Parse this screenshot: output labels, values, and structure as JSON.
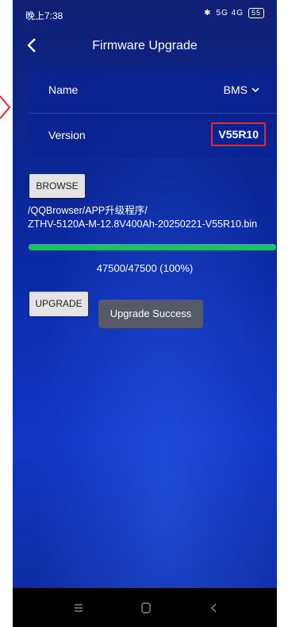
{
  "status_bar": {
    "time": "晚上7:38",
    "signals": "5G  4G",
    "battery": "55"
  },
  "header": {
    "title": "Firmware Upgrade"
  },
  "info": {
    "name_label": "Name",
    "name_value": "BMS",
    "version_label": "Version",
    "version_value": "V55R10"
  },
  "browse_button": "BROWSE",
  "file_path_line1": "/QQBrowser/APP升级程序/",
  "file_path_line2": "ZTHV-5120A-M-12.8V400Ah-20250221-V55R10.bin",
  "progress": {
    "fraction": 1.0,
    "text": "47500/47500 (100%)"
  },
  "upgrade_button": "UPGRADE",
  "toast": "Upgrade Success",
  "colors": {
    "accent_progress": "#1fbf6a",
    "highlight": "#e52a2a",
    "bg": "#0b2aa8"
  }
}
